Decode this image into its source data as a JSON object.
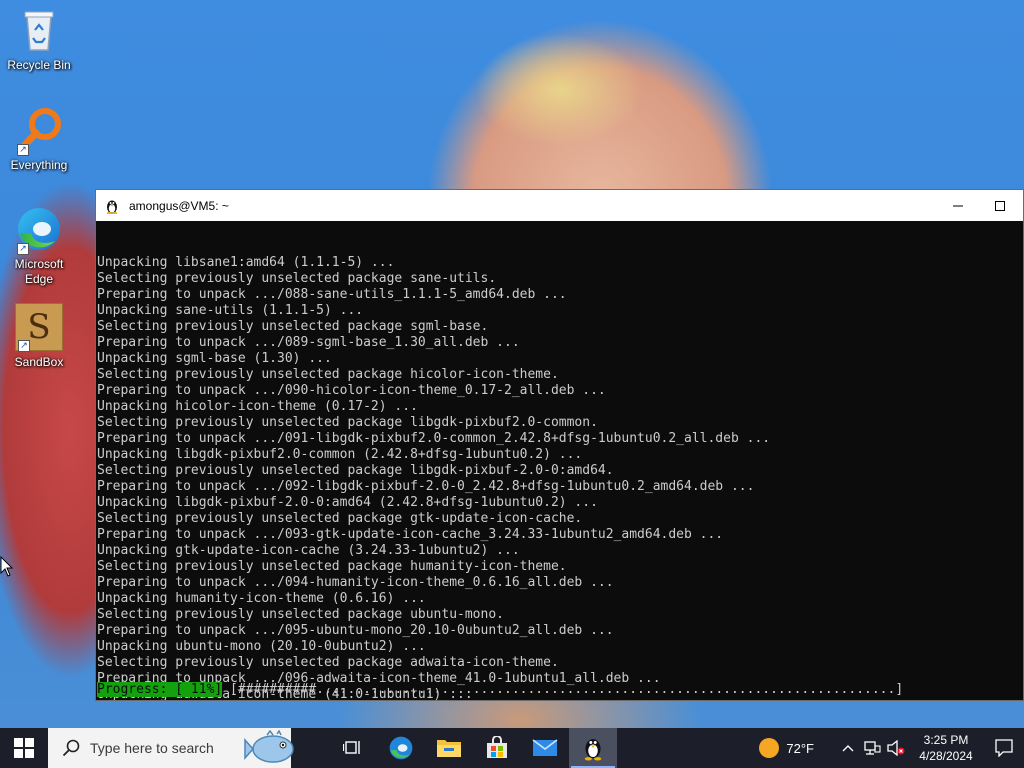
{
  "desktop": {
    "icons": [
      {
        "label": "Recycle Bin",
        "icon": "recycle-bin-icon"
      },
      {
        "label": "Everything",
        "icon": "everything-search-icon"
      },
      {
        "label": "Microsoft Edge",
        "icon": "edge-icon"
      },
      {
        "label": "SandBox",
        "icon": "sandbox-icon",
        "glyph": "S"
      }
    ]
  },
  "terminal": {
    "title": "amongus@VM5: ~",
    "lines": [
      "Unpacking libsane1:amd64 (1.1.1-5) ...",
      "Selecting previously unselected package sane-utils.",
      "Preparing to unpack .../088-sane-utils_1.1.1-5_amd64.deb ...",
      "Unpacking sane-utils (1.1.1-5) ...",
      "Selecting previously unselected package sgml-base.",
      "Preparing to unpack .../089-sgml-base_1.30_all.deb ...",
      "Unpacking sgml-base (1.30) ...",
      "Selecting previously unselected package hicolor-icon-theme.",
      "Preparing to unpack .../090-hicolor-icon-theme_0.17-2_all.deb ...",
      "Unpacking hicolor-icon-theme (0.17-2) ...",
      "Selecting previously unselected package libgdk-pixbuf2.0-common.",
      "Preparing to unpack .../091-libgdk-pixbuf2.0-common_2.42.8+dfsg-1ubuntu0.2_all.deb ...",
      "Unpacking libgdk-pixbuf2.0-common (2.42.8+dfsg-1ubuntu0.2) ...",
      "Selecting previously unselected package libgdk-pixbuf-2.0-0:amd64.",
      "Preparing to unpack .../092-libgdk-pixbuf-2.0-0_2.42.8+dfsg-1ubuntu0.2_amd64.deb ...",
      "Unpacking libgdk-pixbuf-2.0-0:amd64 (2.42.8+dfsg-1ubuntu0.2) ...",
      "Selecting previously unselected package gtk-update-icon-cache.",
      "Preparing to unpack .../093-gtk-update-icon-cache_3.24.33-1ubuntu2_amd64.deb ...",
      "Unpacking gtk-update-icon-cache (3.24.33-1ubuntu2) ...",
      "Selecting previously unselected package humanity-icon-theme.",
      "Preparing to unpack .../094-humanity-icon-theme_0.6.16_all.deb ...",
      "Unpacking humanity-icon-theme (0.6.16) ...",
      "Selecting previously unselected package ubuntu-mono.",
      "Preparing to unpack .../095-ubuntu-mono_20.10-0ubuntu2_all.deb ...",
      "Unpacking ubuntu-mono (20.10-0ubuntu2) ...",
      "Selecting previously unselected package adwaita-icon-theme.",
      "Preparing to unpack .../096-adwaita-icon-theme_41.0-1ubuntu1_all.deb ...",
      "Unpacking adwaita-icon-theme (41.0-1ubuntu1) ..."
    ],
    "progress": {
      "label": "Progress: [ 11%]",
      "bar": " [##########..........................................................................]",
      "percent": 11
    },
    "colors": {
      "background": "#0c0c0c",
      "text": "#cccccc",
      "progress_label_bg": "#13a10e"
    }
  },
  "taskbar": {
    "search_placeholder": "Type here to search",
    "apps": [
      {
        "name": "task-view",
        "icon": "task-view-icon"
      },
      {
        "name": "edge",
        "icon": "edge-icon"
      },
      {
        "name": "file-explorer",
        "icon": "folder-icon"
      },
      {
        "name": "microsoft-store",
        "icon": "store-icon"
      },
      {
        "name": "mail",
        "icon": "mail-icon"
      },
      {
        "name": "wsl-terminal",
        "icon": "tux-icon",
        "active": true
      }
    ],
    "weather": {
      "temp": "72°F",
      "icon": "sun-icon"
    },
    "clock": {
      "time": "3:25 PM",
      "date": "4/28/2024"
    }
  }
}
